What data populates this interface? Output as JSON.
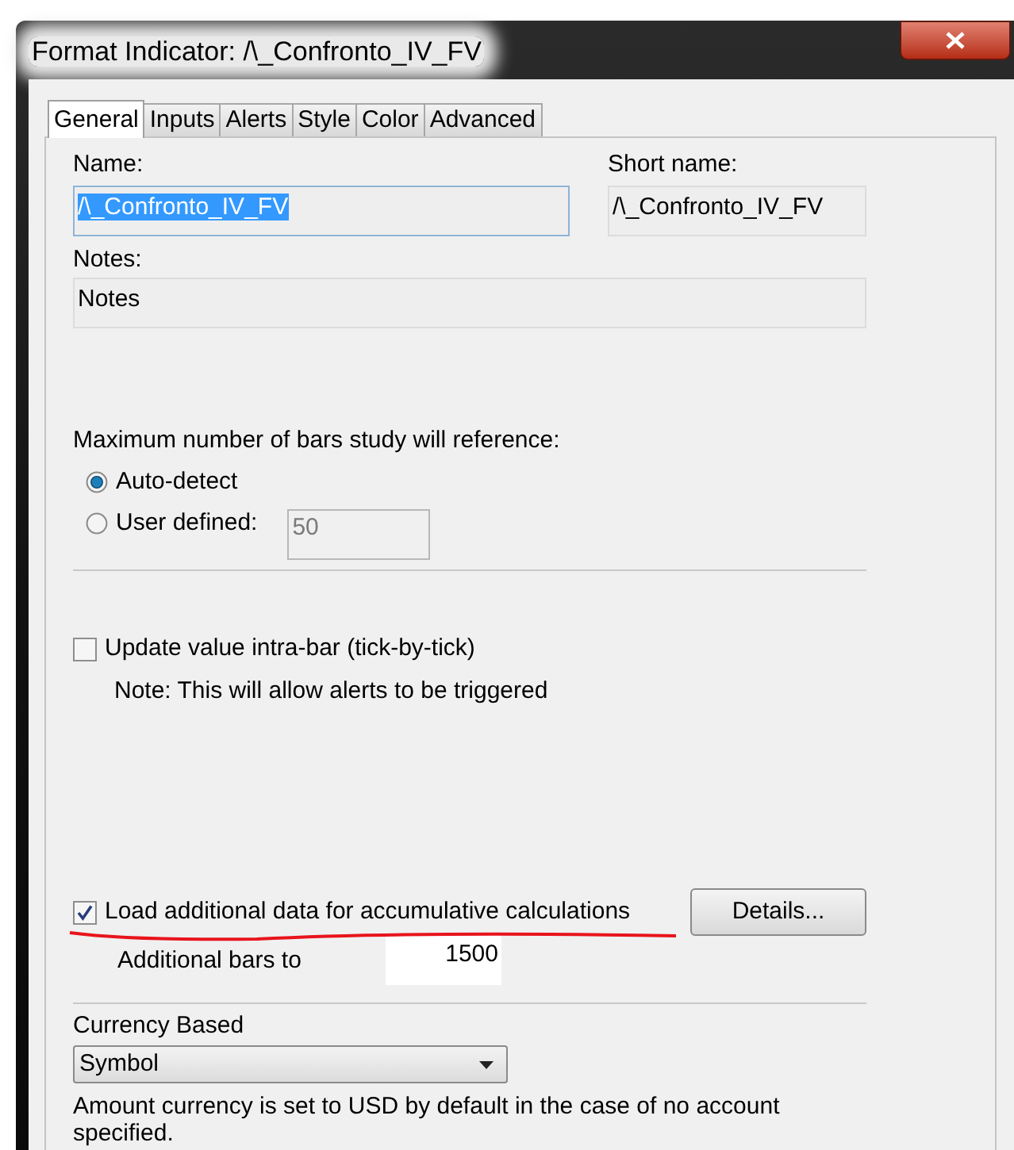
{
  "window": {
    "title": "Format Indicator: /\\_Confronto_IV_FV"
  },
  "tabs": [
    {
      "label": "General",
      "selected": true
    },
    {
      "label": "Inputs",
      "selected": false
    },
    {
      "label": "Alerts",
      "selected": false
    },
    {
      "label": "Style",
      "selected": false
    },
    {
      "label": "Color",
      "selected": false
    },
    {
      "label": "Advanced",
      "selected": false
    }
  ],
  "name": {
    "label": "Name:",
    "value": "/\\_Confronto_IV_FV",
    "selected": true
  },
  "short_name": {
    "label": "Short name:",
    "value": "/\\_Confronto_IV_FV"
  },
  "notes": {
    "label": "Notes:",
    "value": "Notes"
  },
  "max_bars": {
    "label": "Maximum number of bars study will reference:",
    "options": [
      {
        "label": "Auto-detect",
        "selected": true
      },
      {
        "label": "User defined:",
        "selected": false
      }
    ],
    "user_value": "50",
    "disabled": true
  },
  "update_intrabar": {
    "label": "Update value intra-bar (tick-by-tick)",
    "checked": false,
    "note": "Note: This will allow alerts to be triggered"
  },
  "load_additional": {
    "label": "Load additional data for accumulative calculations",
    "checked": true,
    "button": "Details...",
    "bars_label": "Additional bars to",
    "bars_value": "1500"
  },
  "currency": {
    "label": "Currency Based",
    "value": "Symbol"
  },
  "footnote": "Amount currency is set to USD by default in the case of no account specified."
}
